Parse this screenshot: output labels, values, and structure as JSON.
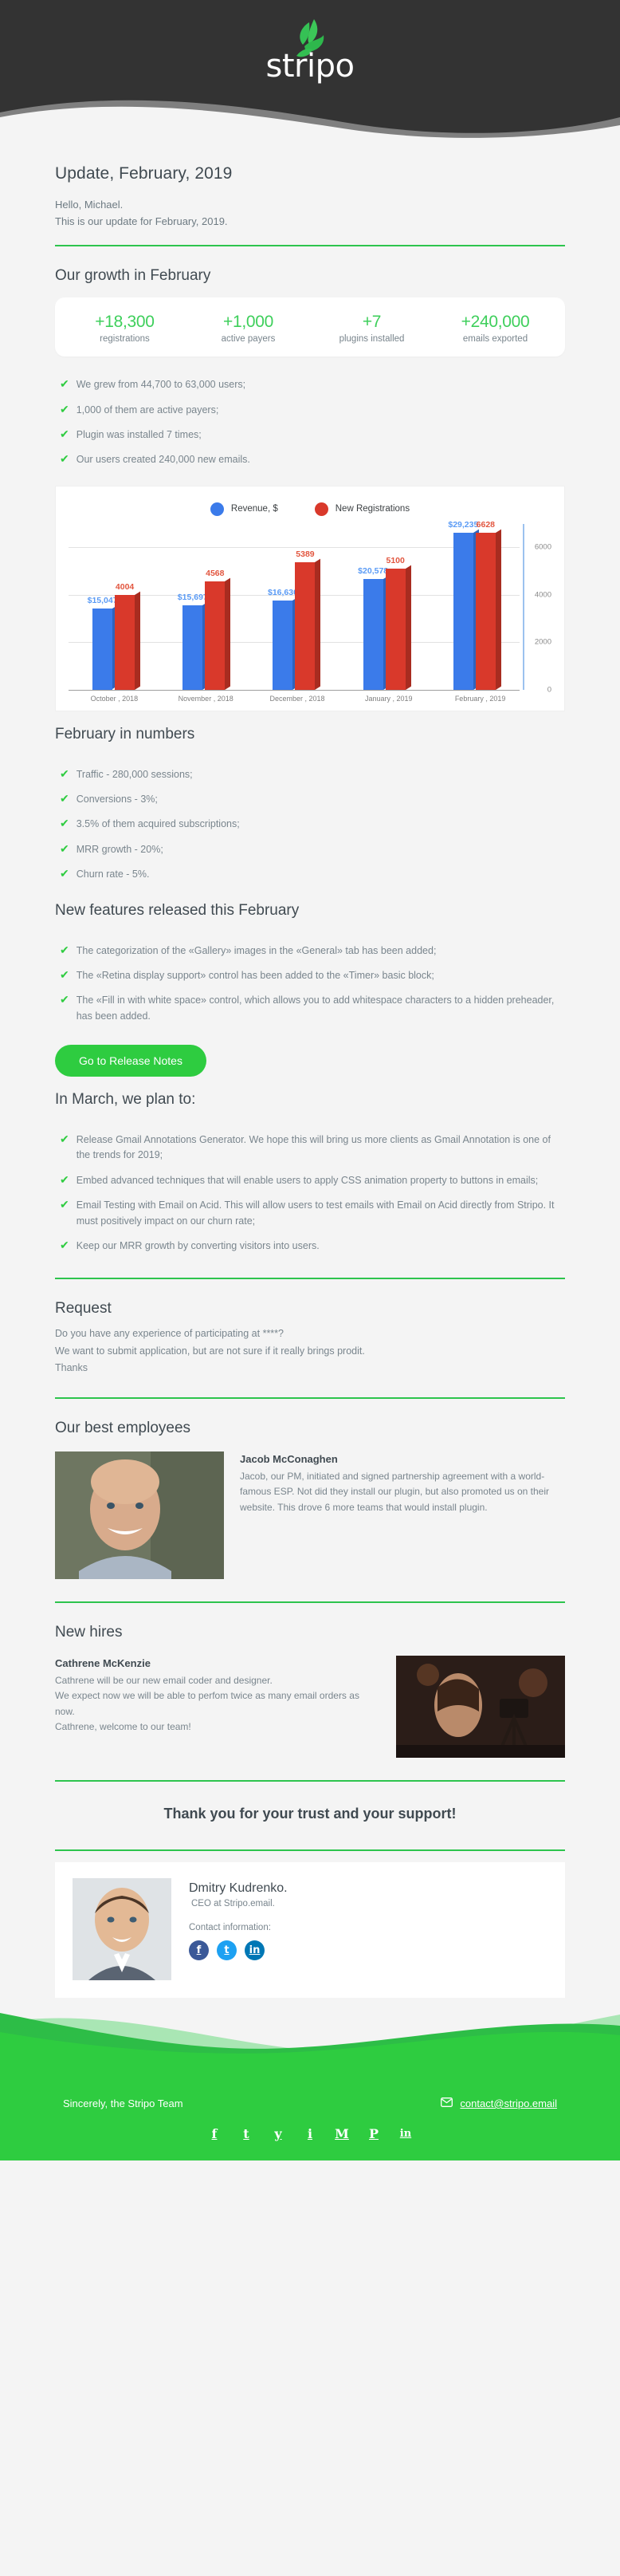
{
  "brand": {
    "name": "stripo",
    "logo_icon": "stripo-leaf-logo",
    "green": "#2ecc40",
    "dark": "#333333"
  },
  "header": {
    "title": "Update, February, 2019",
    "greeting_line1": "Hello, Michael.",
    "greeting_line2": "This is our update for February, 2019."
  },
  "growth": {
    "heading": "Our growth in February",
    "stats": [
      {
        "value": "+18,300",
        "label": "registrations"
      },
      {
        "value": "+1,000",
        "label": "active payers"
      },
      {
        "value": "+7",
        "label": "plugins installed"
      },
      {
        "value": "+240,000",
        "label": "emails exported"
      }
    ],
    "bullets": [
      "We grew from 44,700 to 63,000 users;",
      "1,000 of them are active payers;",
      "Plugin was installed 7 times;",
      "Our users created 240,000 new emails."
    ]
  },
  "chart_data": {
    "type": "bar",
    "title": "",
    "categories": [
      "October , 2018",
      "November , 2018",
      "December , 2018",
      "January , 2019",
      "February , 2019"
    ],
    "series": [
      {
        "name": "Revenue, $",
        "color": "#3b7bea",
        "values": [
          15047,
          15697,
          16630,
          20578,
          29235
        ],
        "labels": [
          "$15,047",
          "$15,697",
          "$16,630",
          "$20,578",
          "$29,235"
        ]
      },
      {
        "name": "New Registrations",
        "color": "#d9392b",
        "values": [
          4004,
          4568,
          5389,
          5100,
          6628
        ],
        "labels": [
          "4004",
          "4568",
          "5389",
          "5100",
          "6628"
        ]
      }
    ],
    "yticks": [
      "0",
      "2000",
      "4000",
      "6000"
    ],
    "ylim": [
      0,
      7000
    ],
    "grid": true,
    "legend_position": "top"
  },
  "numbers": {
    "heading": "February in numbers",
    "bullets": [
      "Traffic - 280,000 sessions;",
      "Conversions - 3%;",
      "3.5% of them acquired subscriptions;",
      "MRR growth - 20%;",
      "Churn rate - 5%."
    ]
  },
  "features": {
    "heading": "New features released this February",
    "bullets": [
      "The categorization of the «Gallery» images in the «General» tab has been added;",
      "The «Retina display support» control  has been added to the «Timer» basic block;",
      "The «Fill in with white space» control, which allows you to add whitespace characters to a hidden preheader, has been added."
    ],
    "cta_label": "Go to Release Notes"
  },
  "plans": {
    "heading": "In March, we plan to:",
    "bullets": [
      "Release Gmail Annotations Generator. We hope this will bring us more clients as Gmail Annotation is one of the trends for 2019;",
      "Embed advanced techniques that will enable users to apply CSS animation property to buttons in emails;",
      "Email Testing with Email on Acid. This will allow users to test emails with Email on Acid directly from Stripo. It must positively impact on our churn rate;",
      "Keep our MRR growth by converting visitors into users."
    ]
  },
  "request": {
    "heading": "Request",
    "line1": "Do you have any experience of participating at ****?",
    "line2": "We want to submit application, but are not sure if it really brings prodit.",
    "line3": "Thanks"
  },
  "employees": {
    "heading": "Our best employees",
    "name": "Jacob McConaghen",
    "photo_icon": "employee-photo",
    "text": "Jacob, our PM, initiated and signed partnership agreement with a world-famous ESP. Not did they install our plugin, but also promoted us on their website. This drove 6 more teams that would install plugin."
  },
  "new_hires": {
    "heading": "New hires",
    "name": "Cathrene McKenzie",
    "photo_icon": "new-hire-photo",
    "lines": [
      "Cathrene will be our new email coder and designer.",
      "We expect now we will be able to perfom twice as many email orders as now.",
      "Cathrene, welcome to our team!"
    ]
  },
  "thanks": "Thank you for your trust and your support!",
  "signature": {
    "photo_icon": "ceo-photo",
    "name": "Dmitry Kudrenko.",
    "role": "CEO at Stripo.email.",
    "contact_label": "Contact information:",
    "socials": [
      {
        "icon": "facebook-icon",
        "glyph": "f",
        "color": "#3b5998"
      },
      {
        "icon": "twitter-icon",
        "glyph": "t",
        "color": "#1da1f2"
      },
      {
        "icon": "linkedin-icon",
        "glyph": "in",
        "color": "#0077b5"
      }
    ]
  },
  "footer": {
    "sign_off": "Sincerely, the Stripo Team",
    "email": "contact@stripo.email",
    "mail_icon": "envelope-icon",
    "socials": [
      {
        "icon": "facebook-icon",
        "glyph": "f"
      },
      {
        "icon": "twitter-icon",
        "glyph": "t"
      },
      {
        "icon": "youtube-icon",
        "glyph": "y"
      },
      {
        "icon": "instagram-icon",
        "glyph": "i"
      },
      {
        "icon": "medium-icon",
        "glyph": "M"
      },
      {
        "icon": "pinterest-icon",
        "glyph": "P"
      },
      {
        "icon": "linkedin-icon",
        "glyph": "in"
      }
    ]
  }
}
